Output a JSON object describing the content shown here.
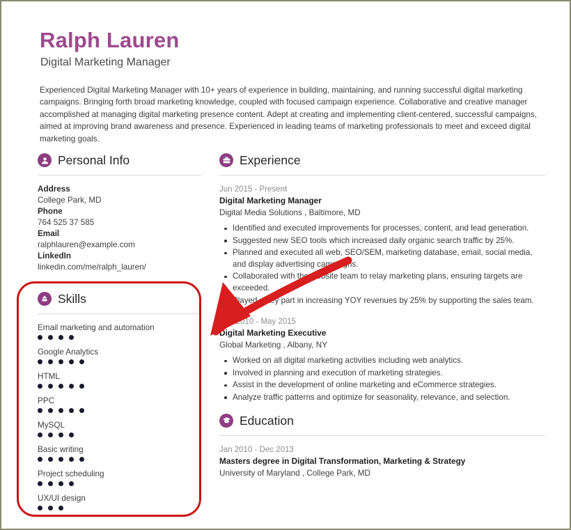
{
  "header": {
    "name": "Ralph Lauren",
    "job_title": "Digital Marketing Manager",
    "name_color": "#9c4a8c",
    "summary": "Experienced Digital Marketing Manager with 10+ years of experience in building, maintaining, and running successful digital marketing campaigns. Bringing forth broad marketing knowledge, coupled with focused campaign experience. Collaborative and creative manager accomplished at managing digital marketing presence content. Adept at creating and implementing client-centered, successful campaigns, aimed at improving brand awareness and presence. Experienced in leading teams of marketing professionals to meet and exceed digital marketing goals."
  },
  "personal_info": {
    "title": "Personal Info",
    "icon": "user-icon",
    "fields": [
      {
        "label": "Address",
        "value": "College Park, MD"
      },
      {
        "label": "Phone",
        "value": "764 525 37 585"
      },
      {
        "label": "Email",
        "value": "ralphlauren@example.com"
      },
      {
        "label": "LinkedIn",
        "value": "linkedin.com/me/ralph_lauren/"
      }
    ]
  },
  "skills": {
    "title": "Skills",
    "icon": "puzzle-icon",
    "max_dots": 5,
    "items": [
      {
        "name": "Email marketing and automation",
        "level": 4
      },
      {
        "name": "Google Analytics",
        "level": 5
      },
      {
        "name": "HTML",
        "level": 5
      },
      {
        "name": "PPC",
        "level": 5
      },
      {
        "name": "MySQL",
        "level": 4
      },
      {
        "name": "Basic writing",
        "level": 5
      },
      {
        "name": "Project scheduling",
        "level": 4
      },
      {
        "name": "UX/UI design",
        "level": 3
      }
    ]
  },
  "experience": {
    "title": "Experience",
    "icon": "briefcase-icon",
    "entries": [
      {
        "date": "Jun 2015 - Present",
        "role": "Digital Marketing Manager",
        "org": "Digital Media Solutions , Baltimore, MD",
        "bullets": [
          "Identified and executed improvements for processes, content, and lead generation.",
          "Suggested new SEO tools which increased daily organic search traffic by 25%.",
          "Planned and executed all web, SEO/SEM, marketing database, email, social media, and display advertising campaigns.",
          "Collaborated with the website team to relay marketing plans, ensuring targets are exceeded.",
          "Played a key part in increasing YOY revenues by 25% by supporting the sales team."
        ]
      },
      {
        "date": "Dec 2010 - May 2015",
        "role": "Digital Marketing Executive",
        "org": "Global Marketing , Albany, NY",
        "bullets": [
          "Worked on all digital marketing activities including web analytics.",
          "Involved in planning and execution of marketing strategies.",
          "Assist in the development of online marketing and eCommerce strategies.",
          "Analyze traffic patterns and optimize for seasonality, relevance, and selection."
        ]
      }
    ]
  },
  "education": {
    "title": "Education",
    "icon": "graduation-cap-icon",
    "entries": [
      {
        "date": "Jan 2010 - Dec 2013",
        "degree": "Masters degree in Digital Transformation, Marketing & Strategy",
        "school": "University of Maryland , College Park, MD"
      }
    ]
  },
  "annotations": {
    "highlight_color": "#cc1111",
    "skills_highlight_box": true,
    "arrow_to_skills": true
  }
}
